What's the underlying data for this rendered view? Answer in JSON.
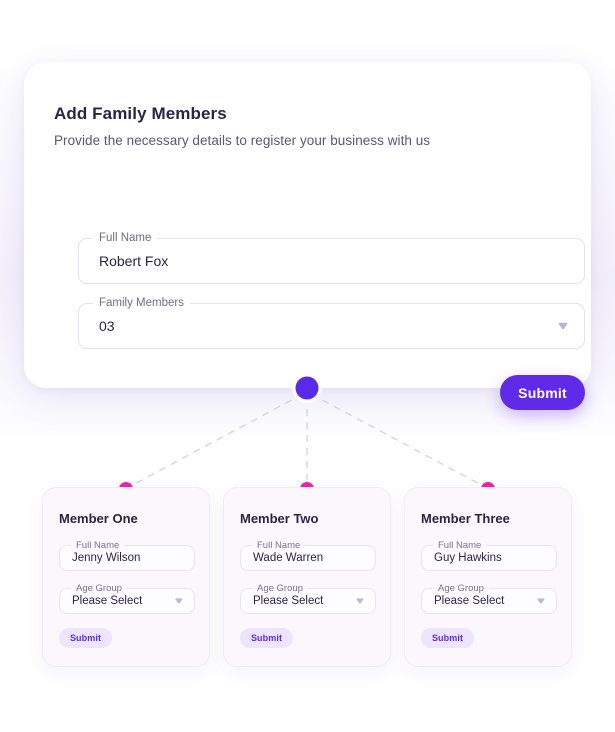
{
  "theme": {
    "accent_purple": "#6129e8",
    "node_purple": "#5b2ae8",
    "node_pink": "#f91ca8",
    "text_dark": "#2b2447",
    "text_muted": "#5a5775",
    "page_background": "#ffffff",
    "card_background": "#ffffff",
    "member_card_background": "#faf8fc",
    "small_button_background": "#ece5fd"
  },
  "main_card": {
    "title": "Add Family Members",
    "subtitle": "Provide the necessary details to register your business with us",
    "fields": [
      {
        "label": "Full Name",
        "value": "Robert Fox",
        "placeholder": "Full Name",
        "type": "text"
      },
      {
        "label": "Family Members",
        "value": "03",
        "placeholder": "Family Members",
        "type": "select",
        "icon": "chevron-down-icon"
      }
    ],
    "submit_label": "Submit"
  },
  "connector": {
    "root_node_icon": "root-node-dot",
    "child_node_icon": "child-node-dot",
    "line_style": "dashed"
  },
  "members": [
    {
      "title": "Member One",
      "name_label": "Full Name",
      "name_value": "Jenny Wilson",
      "age_label": "Age Group",
      "age_value": "Please Select",
      "age_icon": "chevron-down-icon",
      "submit_label": "Submit"
    },
    {
      "title": "Member Two",
      "name_label": "Full Name",
      "name_value": "Wade Warren",
      "age_label": "Age Group",
      "age_value": "Please Select",
      "age_icon": "chevron-down-icon",
      "submit_label": "Submit"
    },
    {
      "title": "Member Three",
      "name_label": "Full Name",
      "name_value": "Guy Hawkins",
      "age_label": "Age Group",
      "age_value": "Please Select",
      "age_icon": "chevron-down-icon",
      "submit_label": "Submit"
    }
  ]
}
